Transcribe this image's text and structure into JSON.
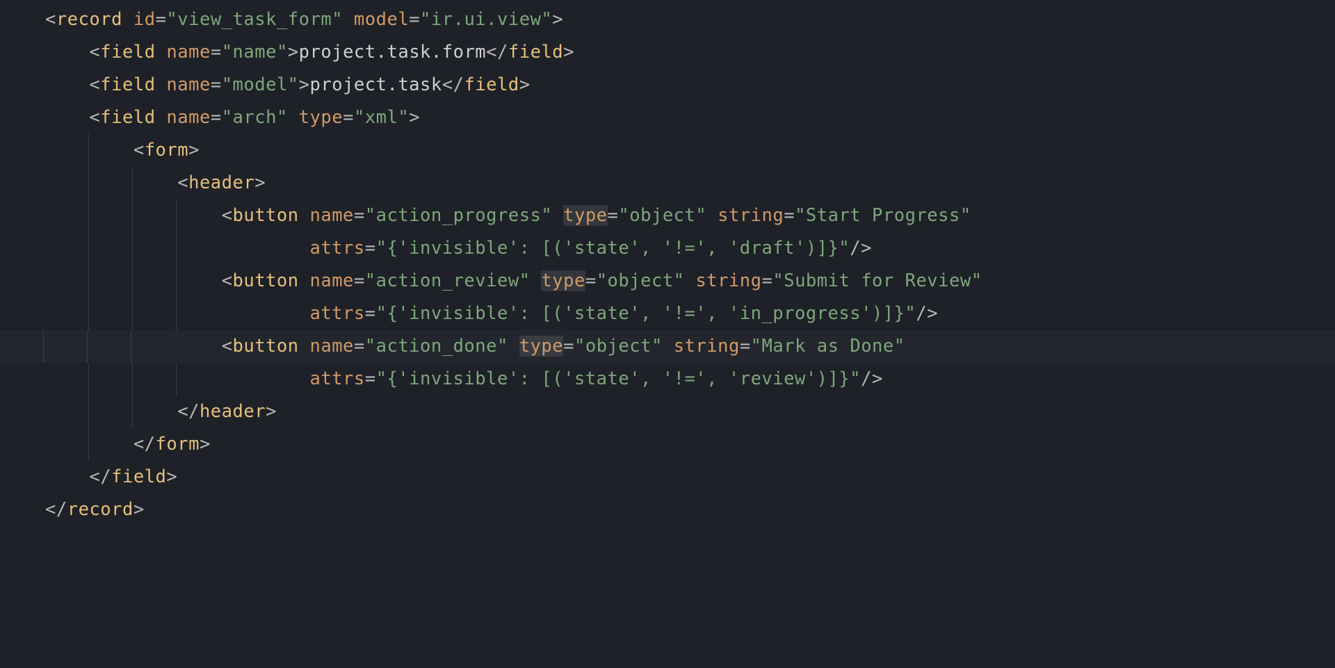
{
  "language": "xml",
  "highlighted_line_index": 10,
  "selection_text": "type",
  "syntax_colors": {
    "punctuation": "#b8b8b8",
    "tag": "#e5c07b",
    "attr": "#d19a66",
    "string": "#7ea77b",
    "text": "#cfcfcf",
    "background": "#1e2128",
    "highlight_bg": "rgba(255,255,255,0.025)",
    "selection_bg": "rgba(255,255,255,0.10)",
    "guide": "#3a3f46"
  },
  "code_text": "<record id=\"view_task_form\" model=\"ir.ui.view\">\n    <field name=\"name\">project.task.form</field>\n    <field name=\"model\">project.task</field>\n    <field name=\"arch\" type=\"xml\">\n        <form>\n            <header>\n                <button name=\"action_progress\" type=\"object\" string=\"Start Progress\"\n                        attrs=\"{'invisible': [('state', '!=', 'draft')]}\"/>\n                <button name=\"action_review\" type=\"object\" string=\"Submit for Review\"\n                        attrs=\"{'invisible': [('state', '!=', 'in_progress')]}\"/>\n                <button name=\"action_done\" type=\"object\" string=\"Mark as Done\"\n                        attrs=\"{'invisible': [('state', '!=', 'review')]}\"/>\n            </header>\n        </form>\n    </field>\n</record>",
  "l": {
    "0": {
      "indent": 0,
      "tokens": [
        [
          "punc",
          "<"
        ],
        [
          "tag",
          "record"
        ],
        [
          "txt",
          " "
        ],
        [
          "attr",
          "id"
        ],
        [
          "punc",
          "="
        ],
        [
          "str",
          "\"view_task_form\""
        ],
        [
          "txt",
          " "
        ],
        [
          "attr",
          "model"
        ],
        [
          "punc",
          "="
        ],
        [
          "str",
          "\"ir.ui.view\""
        ],
        [
          "punc",
          ">"
        ]
      ]
    },
    "1": {
      "indent": 1,
      "tokens": [
        [
          "punc",
          "<"
        ],
        [
          "tag",
          "field"
        ],
        [
          "txt",
          " "
        ],
        [
          "attr",
          "name"
        ],
        [
          "punc",
          "="
        ],
        [
          "str",
          "\"name\""
        ],
        [
          "punc",
          ">"
        ],
        [
          "txt",
          "project.task.form"
        ],
        [
          "punc",
          "</"
        ],
        [
          "tag",
          "field"
        ],
        [
          "punc",
          ">"
        ]
      ]
    },
    "2": {
      "indent": 1,
      "tokens": [
        [
          "punc",
          "<"
        ],
        [
          "tag",
          "field"
        ],
        [
          "txt",
          " "
        ],
        [
          "attr",
          "name"
        ],
        [
          "punc",
          "="
        ],
        [
          "str",
          "\"model\""
        ],
        [
          "punc",
          ">"
        ],
        [
          "txt",
          "project.task"
        ],
        [
          "punc",
          "</"
        ],
        [
          "tag",
          "field"
        ],
        [
          "punc",
          ">"
        ]
      ]
    },
    "3": {
      "indent": 1,
      "tokens": [
        [
          "punc",
          "<"
        ],
        [
          "tag",
          "field"
        ],
        [
          "txt",
          " "
        ],
        [
          "attr",
          "name"
        ],
        [
          "punc",
          "="
        ],
        [
          "str",
          "\"arch\""
        ],
        [
          "txt",
          " "
        ],
        [
          "attr",
          "type"
        ],
        [
          "punc",
          "="
        ],
        [
          "str",
          "\"xml\""
        ],
        [
          "punc",
          ">"
        ]
      ]
    },
    "4": {
      "indent": 2,
      "tokens": [
        [
          "punc",
          "<"
        ],
        [
          "tag",
          "form"
        ],
        [
          "punc",
          ">"
        ]
      ]
    },
    "5": {
      "indent": 3,
      "tokens": [
        [
          "punc",
          "<"
        ],
        [
          "tag",
          "header"
        ],
        [
          "punc",
          ">"
        ]
      ]
    },
    "6": {
      "indent": 4,
      "tokens": [
        [
          "punc",
          "<"
        ],
        [
          "tag",
          "button"
        ],
        [
          "txt",
          " "
        ],
        [
          "attr",
          "name"
        ],
        [
          "punc",
          "="
        ],
        [
          "str",
          "\"action_progress\""
        ],
        [
          "txt",
          " "
        ],
        [
          "selattr",
          "type"
        ],
        [
          "punc",
          "="
        ],
        [
          "str",
          "\"object\""
        ],
        [
          "txt",
          " "
        ],
        [
          "attr",
          "string"
        ],
        [
          "punc",
          "="
        ],
        [
          "str",
          "\"Start Progress\""
        ]
      ]
    },
    "7": {
      "indent": 4,
      "extra": "        ",
      "tokens": [
        [
          "attr",
          "attrs"
        ],
        [
          "punc",
          "="
        ],
        [
          "str",
          "\"{'invisible': [('state', '!=', 'draft')]}\""
        ],
        [
          "punc",
          "/>"
        ]
      ]
    },
    "8": {
      "indent": 4,
      "tokens": [
        [
          "punc",
          "<"
        ],
        [
          "tag",
          "button"
        ],
        [
          "txt",
          " "
        ],
        [
          "attr",
          "name"
        ],
        [
          "punc",
          "="
        ],
        [
          "str",
          "\"action_review\""
        ],
        [
          "txt",
          " "
        ],
        [
          "selattr",
          "type"
        ],
        [
          "punc",
          "="
        ],
        [
          "str",
          "\"object\""
        ],
        [
          "txt",
          " "
        ],
        [
          "attr",
          "string"
        ],
        [
          "punc",
          "="
        ],
        [
          "str",
          "\"Submit for Review\""
        ]
      ]
    },
    "9": {
      "indent": 4,
      "extra": "        ",
      "tokens": [
        [
          "attr",
          "attrs"
        ],
        [
          "punc",
          "="
        ],
        [
          "str",
          "\"{'invisible': [('state', '!=', 'in_progress')]}\""
        ],
        [
          "punc",
          "/>"
        ]
      ]
    },
    "10": {
      "indent": 4,
      "tokens": [
        [
          "punc",
          "<"
        ],
        [
          "tag",
          "button"
        ],
        [
          "txt",
          " "
        ],
        [
          "attr",
          "name"
        ],
        [
          "punc",
          "="
        ],
        [
          "str",
          "\"action_done\""
        ],
        [
          "txt",
          " "
        ],
        [
          "selattr",
          "type"
        ],
        [
          "punc",
          "="
        ],
        [
          "str",
          "\"object\""
        ],
        [
          "txt",
          " "
        ],
        [
          "attr",
          "string"
        ],
        [
          "punc",
          "="
        ],
        [
          "str",
          "\"Mark as Done\""
        ]
      ]
    },
    "11": {
      "indent": 4,
      "extra": "        ",
      "tokens": [
        [
          "attr",
          "attrs"
        ],
        [
          "punc",
          "="
        ],
        [
          "str",
          "\"{'invisible': [('state', '!=', 'review')]}\""
        ],
        [
          "punc",
          "/>"
        ]
      ]
    },
    "12": {
      "indent": 3,
      "tokens": [
        [
          "punc",
          "</"
        ],
        [
          "tag",
          "header"
        ],
        [
          "punc",
          ">"
        ]
      ]
    },
    "13": {
      "indent": 2,
      "tokens": [
        [
          "punc",
          "</"
        ],
        [
          "tag",
          "form"
        ],
        [
          "punc",
          ">"
        ]
      ]
    },
    "14": {
      "indent": 1,
      "tokens": [
        [
          "punc",
          "</"
        ],
        [
          "tag",
          "field"
        ],
        [
          "punc",
          ">"
        ]
      ]
    },
    "15": {
      "indent": 0,
      "tokens": [
        [
          "punc",
          "</"
        ],
        [
          "tag",
          "record"
        ],
        [
          "punc",
          ">"
        ]
      ]
    }
  }
}
